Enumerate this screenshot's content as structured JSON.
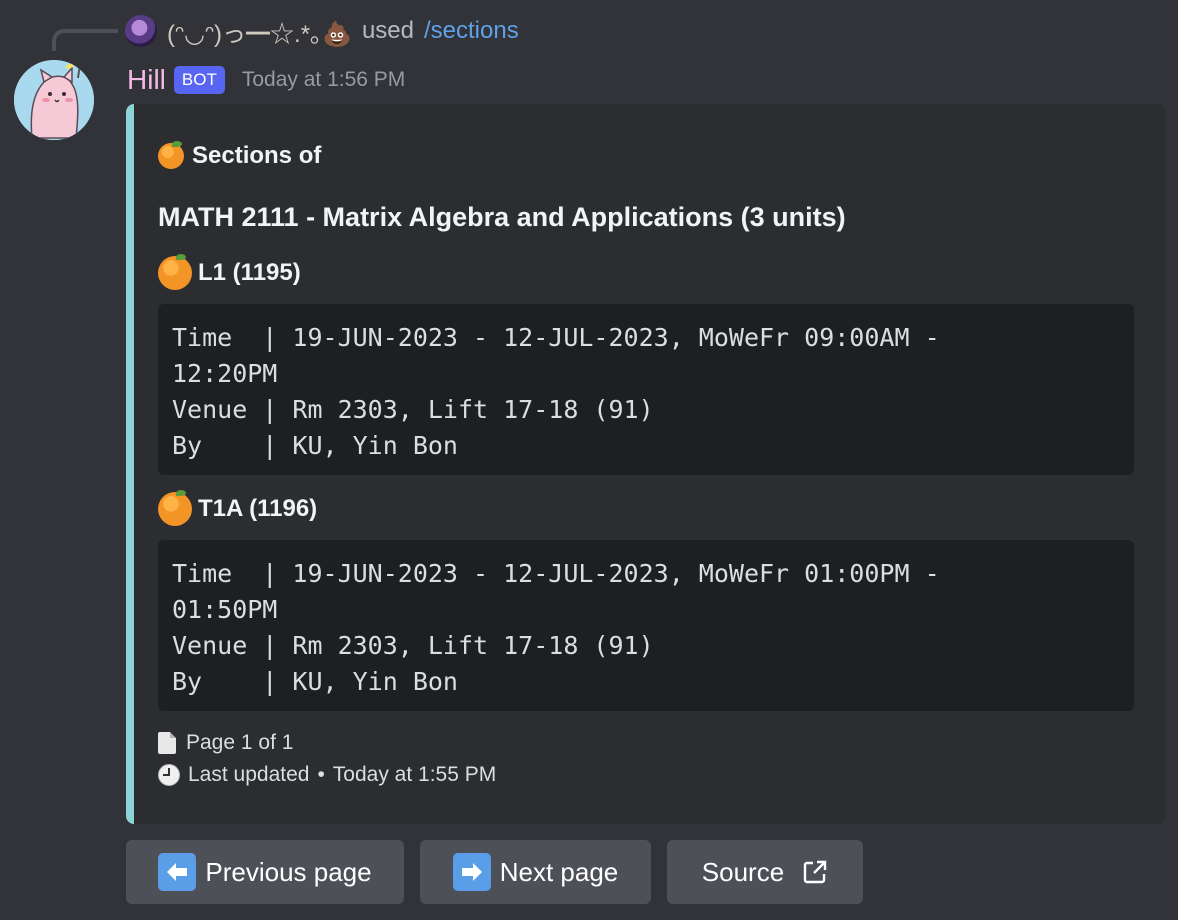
{
  "reply": {
    "username": "(ᵔ◡ᵔ)っ━☆.*｡💩",
    "used_text": "used",
    "command": "/sections"
  },
  "message": {
    "username": "Hill",
    "bot_tag": "BOT",
    "timestamp": "Today at 1:56 PM"
  },
  "embed": {
    "accent_color": "#8bd5d9",
    "author": "Sections of",
    "title": "MATH 2111 - Matrix Algebra and Applications (3 units)",
    "fields": [
      {
        "name": "L1 (1195)",
        "lines": [
          "Time  | 19-JUN-2023 - 12-JUL-2023, MoWeFr 09:00AM -",
          "12:20PM",
          "Venue | Rm 2303, Lift 17-18 (91)",
          "By    | KU, Yin Bon"
        ]
      },
      {
        "name": "T1A (1196)",
        "lines": [
          "Time  | 19-JUN-2023 - 12-JUL-2023, MoWeFr 01:00PM -",
          "01:50PM",
          "Venue | Rm 2303, Lift 17-18 (91)",
          "By    | KU, Yin Bon"
        ]
      }
    ],
    "page_info": "Page 1 of 1",
    "footer_text": "Last updated",
    "footer_separator": "•",
    "footer_timestamp": "Today at 1:55 PM"
  },
  "buttons": {
    "previous": "Previous page",
    "next": "Next page",
    "source": "Source"
  },
  "icons": {
    "author_icon": "tangerine-icon",
    "field_icon": "orange-circle-icon",
    "page_icon": "page-icon",
    "clock_icon": "clock-icon",
    "previous_icon": "left-arrow-icon",
    "next_icon": "right-arrow-icon",
    "source_icon": "external-link-icon"
  }
}
